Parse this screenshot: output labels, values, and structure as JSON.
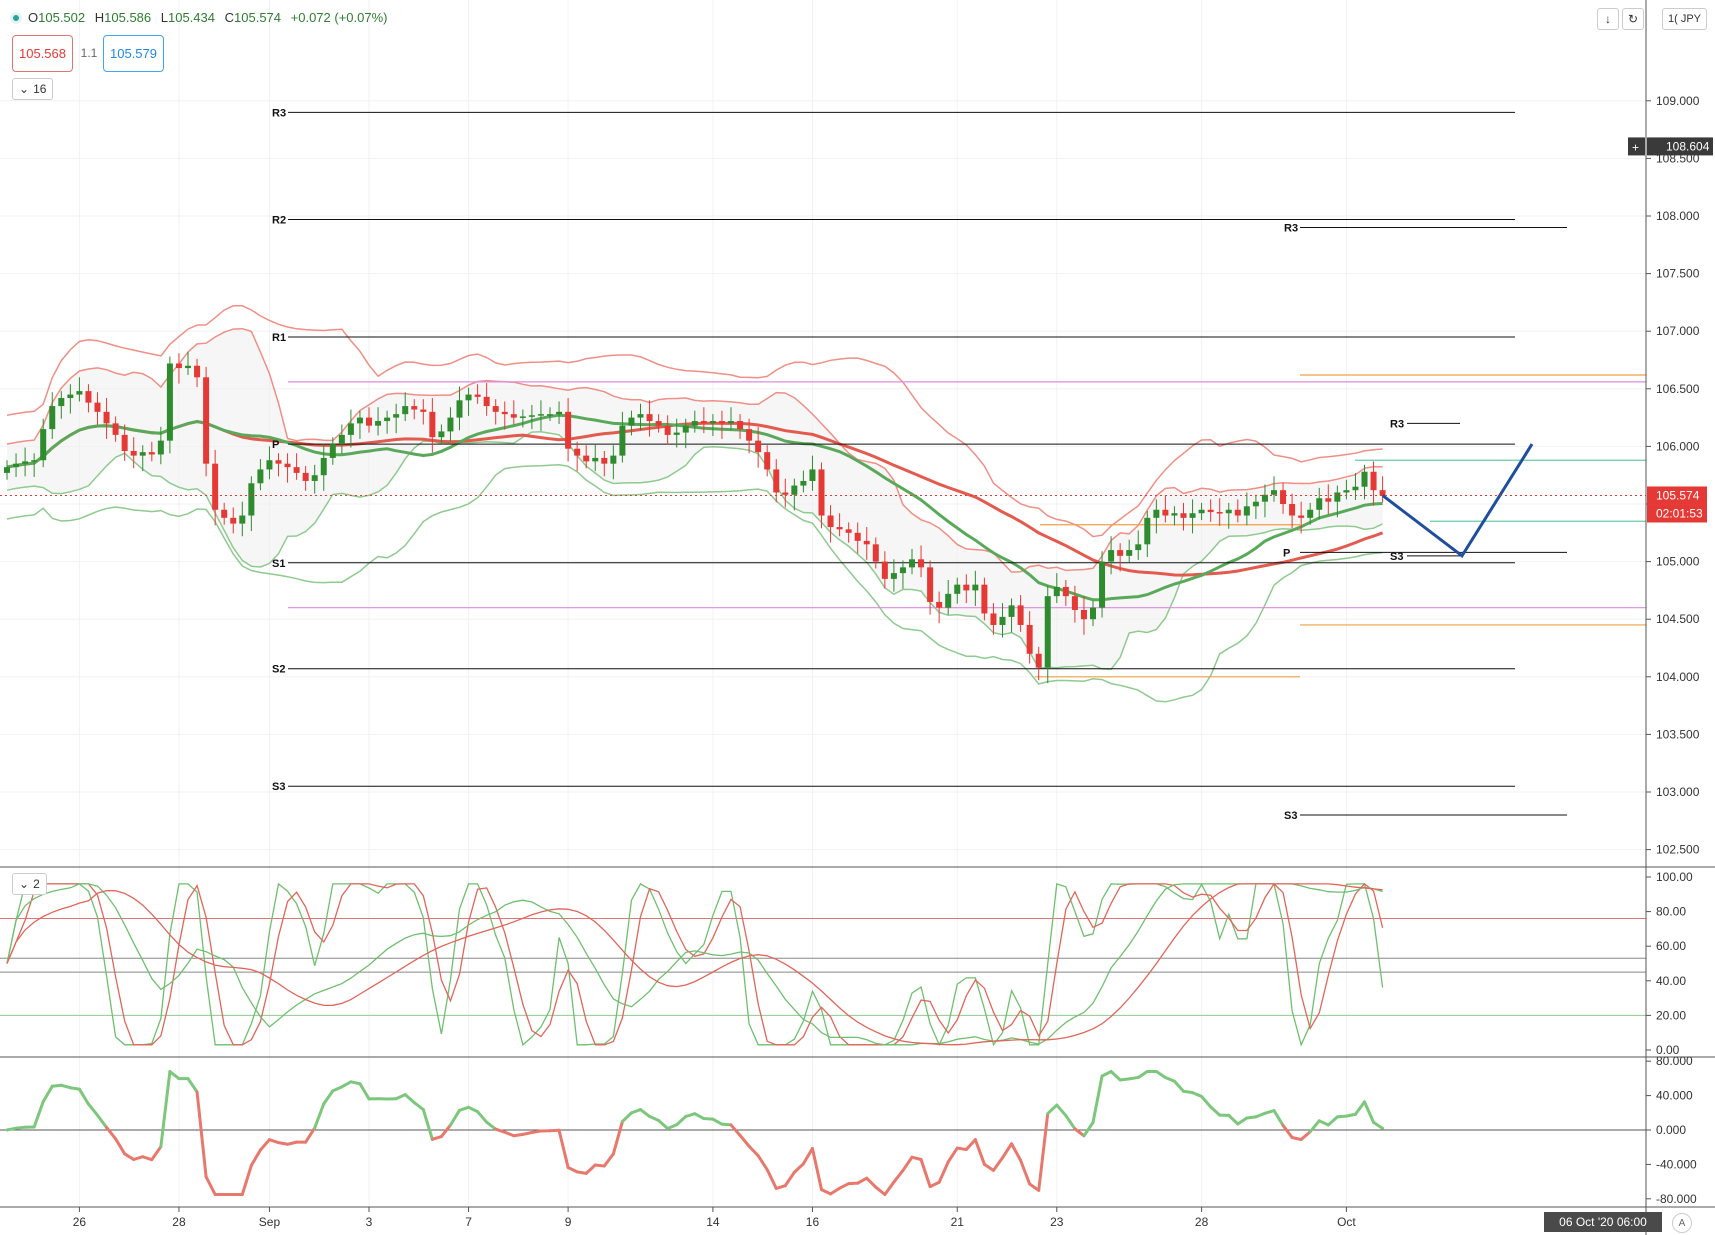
{
  "header": {
    "ohlc": {
      "o_label": "O",
      "o": "105.502",
      "h_label": "H",
      "h": "105.586",
      "l_label": "L",
      "l": "105.434",
      "c_label": "C",
      "c": "105.574",
      "change": "+0.072 (+0.07%)"
    },
    "bid": "105.568",
    "spread": "1.1",
    "ask": "105.579",
    "interval_pill": "16",
    "pane2_pill": "2",
    "currency": "JPY",
    "sym_partial": "1(",
    "date_box": "06 Oct '20   06:00",
    "a_button": "A"
  },
  "colors": {
    "up": "#2e8b2e",
    "down": "#e53935",
    "band_red": "#ef8f85",
    "band_green": "#8fca8f",
    "ma_red": "#e35a4f",
    "ma_green": "#5aa95a",
    "pivot": "#111111",
    "magenta": "#e08ae0",
    "orange": "#f0a040",
    "teal": "#66ccaa",
    "forecast": "#1f4e9c"
  },
  "chart_data": [
    {
      "type": "candlestick",
      "title": "",
      "ylim": [
        102.2,
        109.25
      ],
      "y_ticks": [
        "109.000",
        "108.500",
        "108.000",
        "107.500",
        "107.000",
        "106.500",
        "106.000",
        "105.500",
        "105.000",
        "104.500",
        "104.000",
        "103.500",
        "103.000",
        "102.500"
      ],
      "x_ticks": [
        "26",
        "28",
        "Sep",
        "3",
        "7",
        "9",
        "14",
        "16",
        "21",
        "23",
        "28",
        "Oct"
      ],
      "last_price_tag": "105.574",
      "countdown_tag": "02:01:53",
      "crosshair_tag": "108.604",
      "closes": [
        105.82,
        105.85,
        105.87,
        105.88,
        106.15,
        106.35,
        106.42,
        106.45,
        106.48,
        106.38,
        106.3,
        106.2,
        106.1,
        105.96,
        105.92,
        105.95,
        105.93,
        106.05,
        106.72,
        106.68,
        106.7,
        106.6,
        105.85,
        105.45,
        105.38,
        105.33,
        105.4,
        105.68,
        105.8,
        105.88,
        105.85,
        105.82,
        105.77,
        105.7,
        105.75,
        105.9,
        106.02,
        106.1,
        106.2,
        106.25,
        106.18,
        106.22,
        106.25,
        106.28,
        106.35,
        106.32,
        106.3,
        106.08,
        106.13,
        106.25,
        106.4,
        106.45,
        106.43,
        106.35,
        106.3,
        106.28,
        106.25,
        106.26,
        106.27,
        106.28,
        106.28,
        106.3,
        105.98,
        105.92,
        105.87,
        105.9,
        105.85,
        105.92,
        106.18,
        106.25,
        106.28,
        106.22,
        106.18,
        106.1,
        106.12,
        106.18,
        106.22,
        106.2,
        106.22,
        106.2,
        106.22,
        106.15,
        106.05,
        105.95,
        105.8,
        105.6,
        105.58,
        105.66,
        105.7,
        105.8,
        105.4,
        105.3,
        105.28,
        105.25,
        105.18,
        105.15,
        105.0,
        104.85,
        104.9,
        104.95,
        105.02,
        104.95,
        104.65,
        104.6,
        104.72,
        104.8,
        104.75,
        104.8,
        104.55,
        104.45,
        104.52,
        104.62,
        104.45,
        104.2,
        104.08,
        104.7,
        104.78,
        104.7,
        104.58,
        104.5,
        104.6,
        105.0,
        105.1,
        105.05,
        105.1,
        105.15,
        105.38,
        105.45,
        105.4,
        105.42,
        105.38,
        105.42,
        105.45,
        105.43,
        105.42,
        105.45,
        105.4,
        105.48,
        105.52,
        105.58,
        105.62,
        105.5,
        105.4,
        105.38,
        105.45,
        105.55,
        105.52,
        105.6,
        105.62,
        105.65,
        105.78,
        105.62,
        105.574
      ],
      "pivots_monthly": {
        "R3": 108.9,
        "R2": 107.97,
        "R1": 106.95,
        "P": 106.02,
        "S1": 104.99,
        "S2": 104.07,
        "S3": 103.05
      },
      "pivots_weekly": {
        "R3": 107.9,
        "S3": 102.8
      },
      "pivots_daily": {
        "R3": 106.2,
        "P": 105.08,
        "S3": 105.05
      },
      "magenta_lines": [
        106.56,
        104.6
      ],
      "orange_lines": [
        106.62,
        104.45,
        105.32,
        104.0
      ],
      "teal_lines": [
        105.88,
        105.35
      ],
      "forecast_path": [
        105.574,
        105.05,
        106.02
      ]
    },
    {
      "type": "line",
      "title": "",
      "ylim": [
        0,
        100
      ],
      "y_ticks": [
        "100.00",
        "80.00",
        "60.00",
        "40.00",
        "20.00",
        "0.00"
      ],
      "levels": [
        76,
        53,
        45,
        20
      ]
    },
    {
      "type": "line",
      "title": "",
      "ylim": [
        -80,
        80
      ],
      "y_ticks": [
        "80.000",
        "40.000",
        "0.000",
        "-40.000",
        "-80.000"
      ]
    }
  ]
}
